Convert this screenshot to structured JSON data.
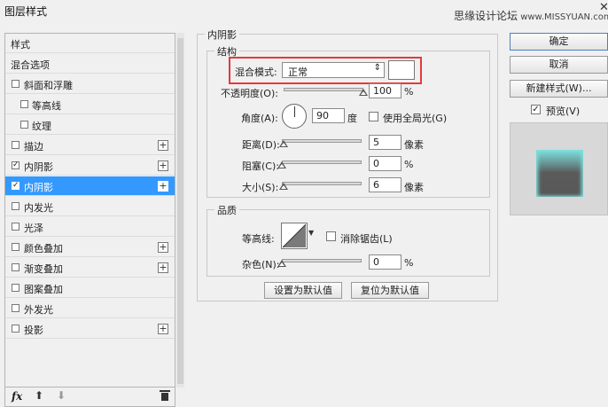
{
  "window": {
    "title": "图层样式",
    "watermark_cn": "思缘设计论坛",
    "watermark_url": "www.MISSYUAN.com",
    "close_glyph": "✕"
  },
  "style_list": {
    "items": [
      {
        "label": "样式",
        "checkbox": false,
        "plus": false
      },
      {
        "label": "混合选项",
        "checkbox": false,
        "plus": false
      },
      {
        "label": "斜面和浮雕",
        "checkbox": true,
        "checked": false,
        "plus": false
      },
      {
        "label": "等高线",
        "checkbox": true,
        "checked": false,
        "plus": false
      },
      {
        "label": "纹理",
        "checkbox": true,
        "checked": false,
        "plus": false
      },
      {
        "label": "描边",
        "checkbox": true,
        "checked": false,
        "plus": true
      },
      {
        "label": "内阴影",
        "checkbox": true,
        "checked": true,
        "plus": true
      },
      {
        "label": "内阴影",
        "checkbox": true,
        "checked": true,
        "plus": true,
        "selected": true
      },
      {
        "label": "内发光",
        "checkbox": true,
        "checked": false,
        "plus": false
      },
      {
        "label": "光泽",
        "checkbox": true,
        "checked": false,
        "plus": false
      },
      {
        "label": "颜色叠加",
        "checkbox": true,
        "checked": false,
        "plus": true
      },
      {
        "label": "渐变叠加",
        "checkbox": true,
        "checked": false,
        "plus": true
      },
      {
        "label": "图案叠加",
        "checkbox": true,
        "checked": false,
        "plus": false
      },
      {
        "label": "外发光",
        "checkbox": true,
        "checked": false,
        "plus": false
      },
      {
        "label": "投影",
        "checkbox": true,
        "checked": false,
        "plus": true
      }
    ],
    "footer": {
      "fx": "fx",
      "up_icon": "arrow-up-icon",
      "down_icon": "arrow-down-icon",
      "trash_icon": "trash-icon"
    }
  },
  "inner_shadow": {
    "title": "内阴影",
    "structure": {
      "title": "结构",
      "blend_mode_label": "混合模式:",
      "blend_mode_value": "正常",
      "opacity_label": "不透明度(O):",
      "opacity_value": "100",
      "opacity_unit": "%",
      "opacity_percent": 100,
      "angle_label": "角度(A):",
      "angle_value": "90",
      "angle_unit": "度",
      "global_light_label": "使用全局光(G)",
      "global_light_checked": false,
      "distance_label": "距离(D):",
      "distance_value": "5",
      "distance_unit": "像素",
      "distance_percent": 2,
      "choke_label": "阻塞(C):",
      "choke_value": "0",
      "choke_unit": "%",
      "choke_percent": 0,
      "size_label": "大小(S):",
      "size_value": "6",
      "size_unit": "像素",
      "size_percent": 2
    },
    "quality": {
      "title": "品质",
      "contour_label": "等高线:",
      "anti_alias_label": "消除锯齿(L)",
      "anti_alias_checked": false,
      "noise_label": "杂色(N):",
      "noise_value": "0",
      "noise_unit": "%",
      "noise_percent": 0
    },
    "set_default_label": "设置为默认值",
    "reset_default_label": "复位为默认值"
  },
  "actions": {
    "ok_label": "确定",
    "cancel_label": "取消",
    "new_style_label": "新建样式(W)...",
    "preview_label": "预览(V)",
    "preview_checked": true
  },
  "colors": {
    "selection": "#3399ff",
    "highlight_box": "#e4393c",
    "preview_glow": "#7de3e0"
  }
}
